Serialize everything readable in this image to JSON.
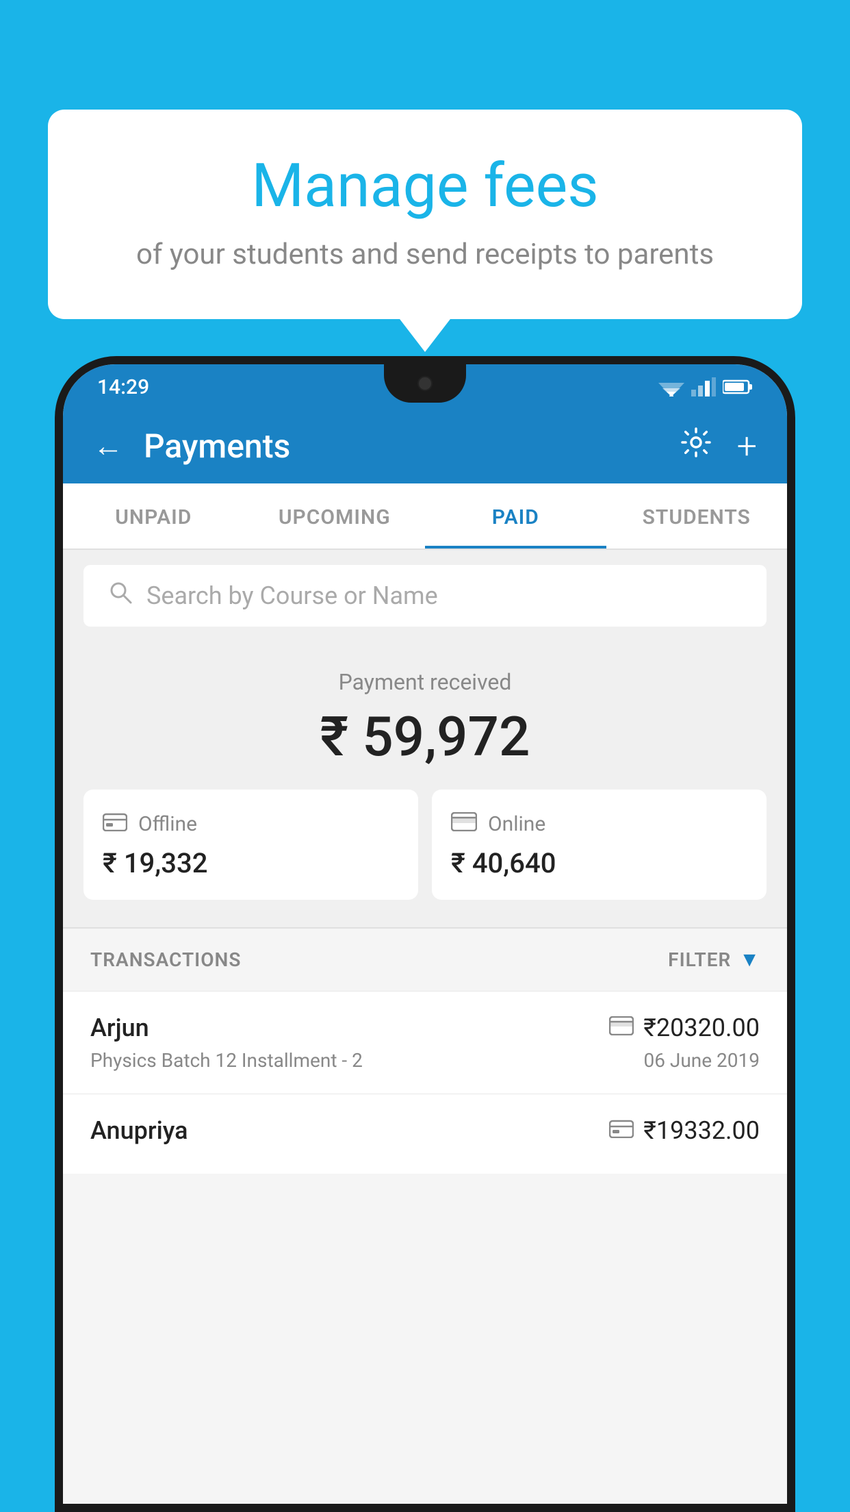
{
  "background_color": "#1ab4e8",
  "speech_bubble": {
    "title": "Manage fees",
    "subtitle": "of your students and send receipts to parents"
  },
  "status_bar": {
    "time": "14:29"
  },
  "header": {
    "title": "Payments",
    "back_label": "←",
    "gear_label": "⚙",
    "plus_label": "+"
  },
  "tabs": [
    {
      "label": "UNPAID",
      "active": false
    },
    {
      "label": "UPCOMING",
      "active": false
    },
    {
      "label": "PAID",
      "active": true
    },
    {
      "label": "STUDENTS",
      "active": false
    }
  ],
  "search": {
    "placeholder": "Search by Course or Name"
  },
  "payment_summary": {
    "label": "Payment received",
    "total": "₹ 59,972",
    "offline_label": "Offline",
    "offline_amount": "₹ 19,332",
    "online_label": "Online",
    "online_amount": "₹ 40,640"
  },
  "transactions_section": {
    "header_label": "TRANSACTIONS",
    "filter_label": "FILTER"
  },
  "transactions": [
    {
      "name": "Arjun",
      "course": "Physics Batch 12 Installment - 2",
      "amount": "₹20320.00",
      "date": "06 June 2019",
      "method": "card"
    },
    {
      "name": "Anupriya",
      "course": "",
      "amount": "₹19332.00",
      "date": "",
      "method": "cash"
    }
  ]
}
